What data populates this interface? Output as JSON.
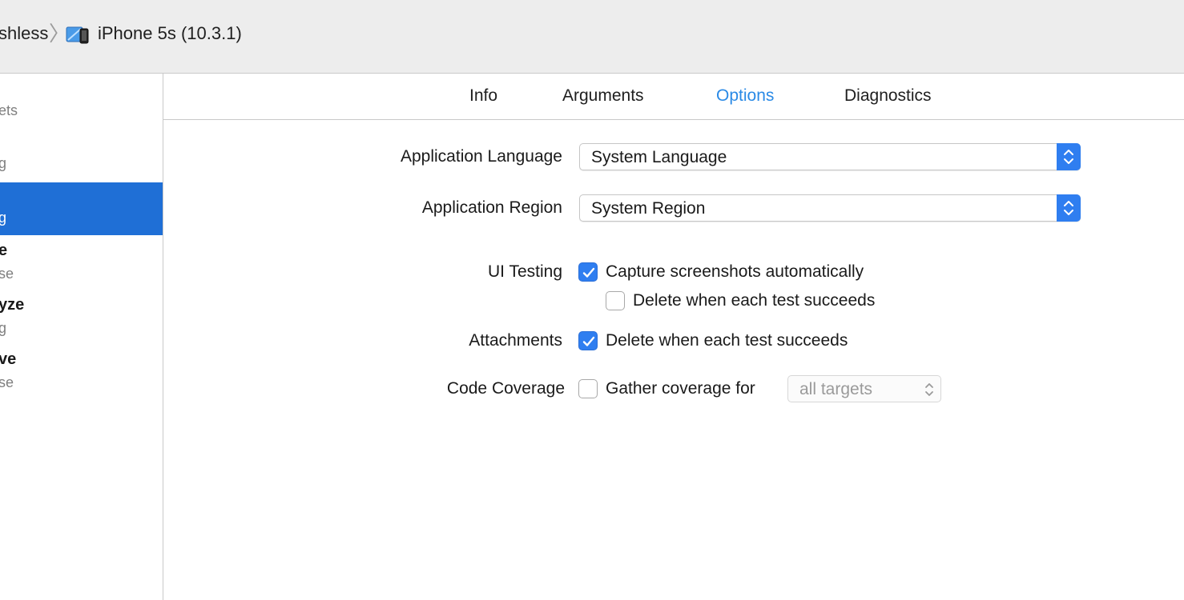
{
  "toolbar": {
    "scheme_partial": "shless",
    "separator": "〉",
    "device_icon": "simulator-device-icon",
    "device_label": "iPhone 5s (10.3.1)"
  },
  "sidebar": {
    "items": [
      {
        "title": "",
        "sub": "ets"
      },
      {
        "title": "",
        "sub": "g"
      },
      {
        "title": "",
        "sub": "g",
        "selected": true
      },
      {
        "title": "e",
        "sub": "se"
      },
      {
        "title": "yze",
        "sub": "g"
      },
      {
        "title": "ve",
        "sub": "se"
      }
    ]
  },
  "tabs": [
    {
      "label": "Info",
      "active": false
    },
    {
      "label": "Arguments",
      "active": false
    },
    {
      "label": "Options",
      "active": true
    },
    {
      "label": "Diagnostics",
      "active": false
    }
  ],
  "form": {
    "app_language": {
      "label": "Application Language",
      "value": "System Language"
    },
    "app_region": {
      "label": "Application Region",
      "value": "System Region"
    },
    "ui_testing": {
      "label": "UI Testing",
      "capture": {
        "label": "Capture screenshots automatically",
        "checked": true
      },
      "delete": {
        "label": "Delete when each test succeeds",
        "checked": false
      }
    },
    "attachments": {
      "label": "Attachments",
      "delete": {
        "label": "Delete when each test succeeds",
        "checked": true
      }
    },
    "code_coverage": {
      "label": "Code Coverage",
      "gather": {
        "label": "Gather coverage for",
        "checked": false
      },
      "targets_value": "all targets"
    }
  },
  "colors": {
    "accent": "#2f7ef0",
    "selection": "#1f6fd6",
    "active_tab": "#2a8ae6"
  }
}
